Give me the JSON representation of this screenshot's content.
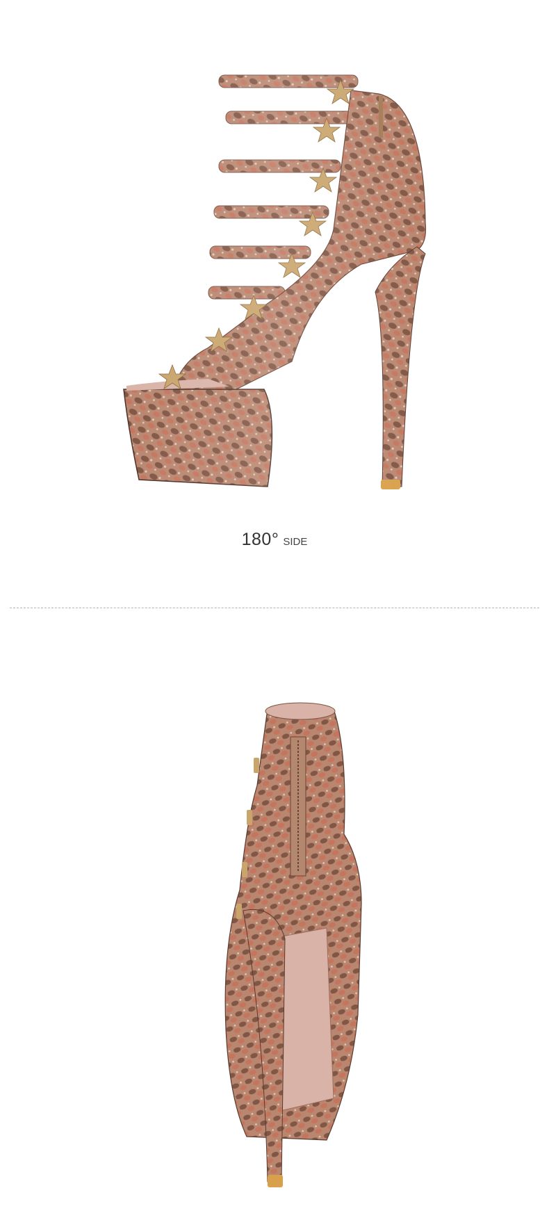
{
  "caption": {
    "angle": "180°",
    "view": "SIDE"
  },
  "images": [
    {
      "name": "shoe-side-view",
      "description_visible": false
    },
    {
      "name": "shoe-back-view",
      "description_visible": false
    }
  ],
  "colors": {
    "snake_base": "#b98770",
    "snake_dark": "#5a3a2e",
    "snake_rust": "#c8715a",
    "star_gold": "#c9a46b",
    "insole": "#d9b3a8",
    "heel_tip": "#d9a04b"
  }
}
